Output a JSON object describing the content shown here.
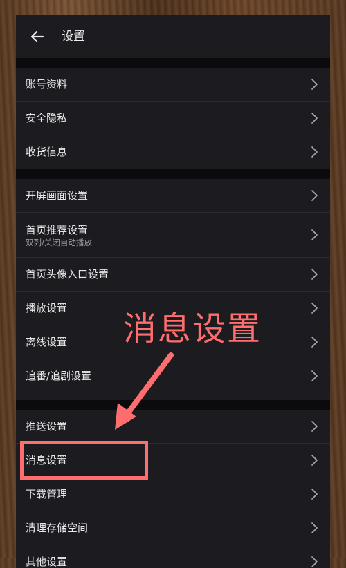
{
  "header": {
    "title": "设置",
    "back_icon": "arrow-left-icon"
  },
  "groups": [
    {
      "items": [
        {
          "label": "账号资料"
        },
        {
          "label": "安全隐私"
        },
        {
          "label": "收货信息"
        }
      ]
    },
    {
      "items": [
        {
          "label": "开屏画面设置"
        },
        {
          "label": "首页推荐设置",
          "sub": "双列/关闭自动播放"
        },
        {
          "label": "首页头像入口设置"
        },
        {
          "label": "播放设置"
        },
        {
          "label": "离线设置"
        },
        {
          "label": "追番/追剧设置"
        }
      ]
    },
    {
      "items": [
        {
          "label": "推送设置"
        },
        {
          "label": "消息设置"
        },
        {
          "label": "下载管理"
        },
        {
          "label": "清理存储空间"
        },
        {
          "label": "其他设置"
        }
      ]
    }
  ],
  "annotation": {
    "text": "消息设置",
    "color": "#ff6e6e",
    "highlight_target": "消息设置"
  },
  "colors": {
    "background": "#1b1b20",
    "separator": "#0b0b0d",
    "text": "#e8e8e8",
    "subtext": "#9a9aa0"
  }
}
